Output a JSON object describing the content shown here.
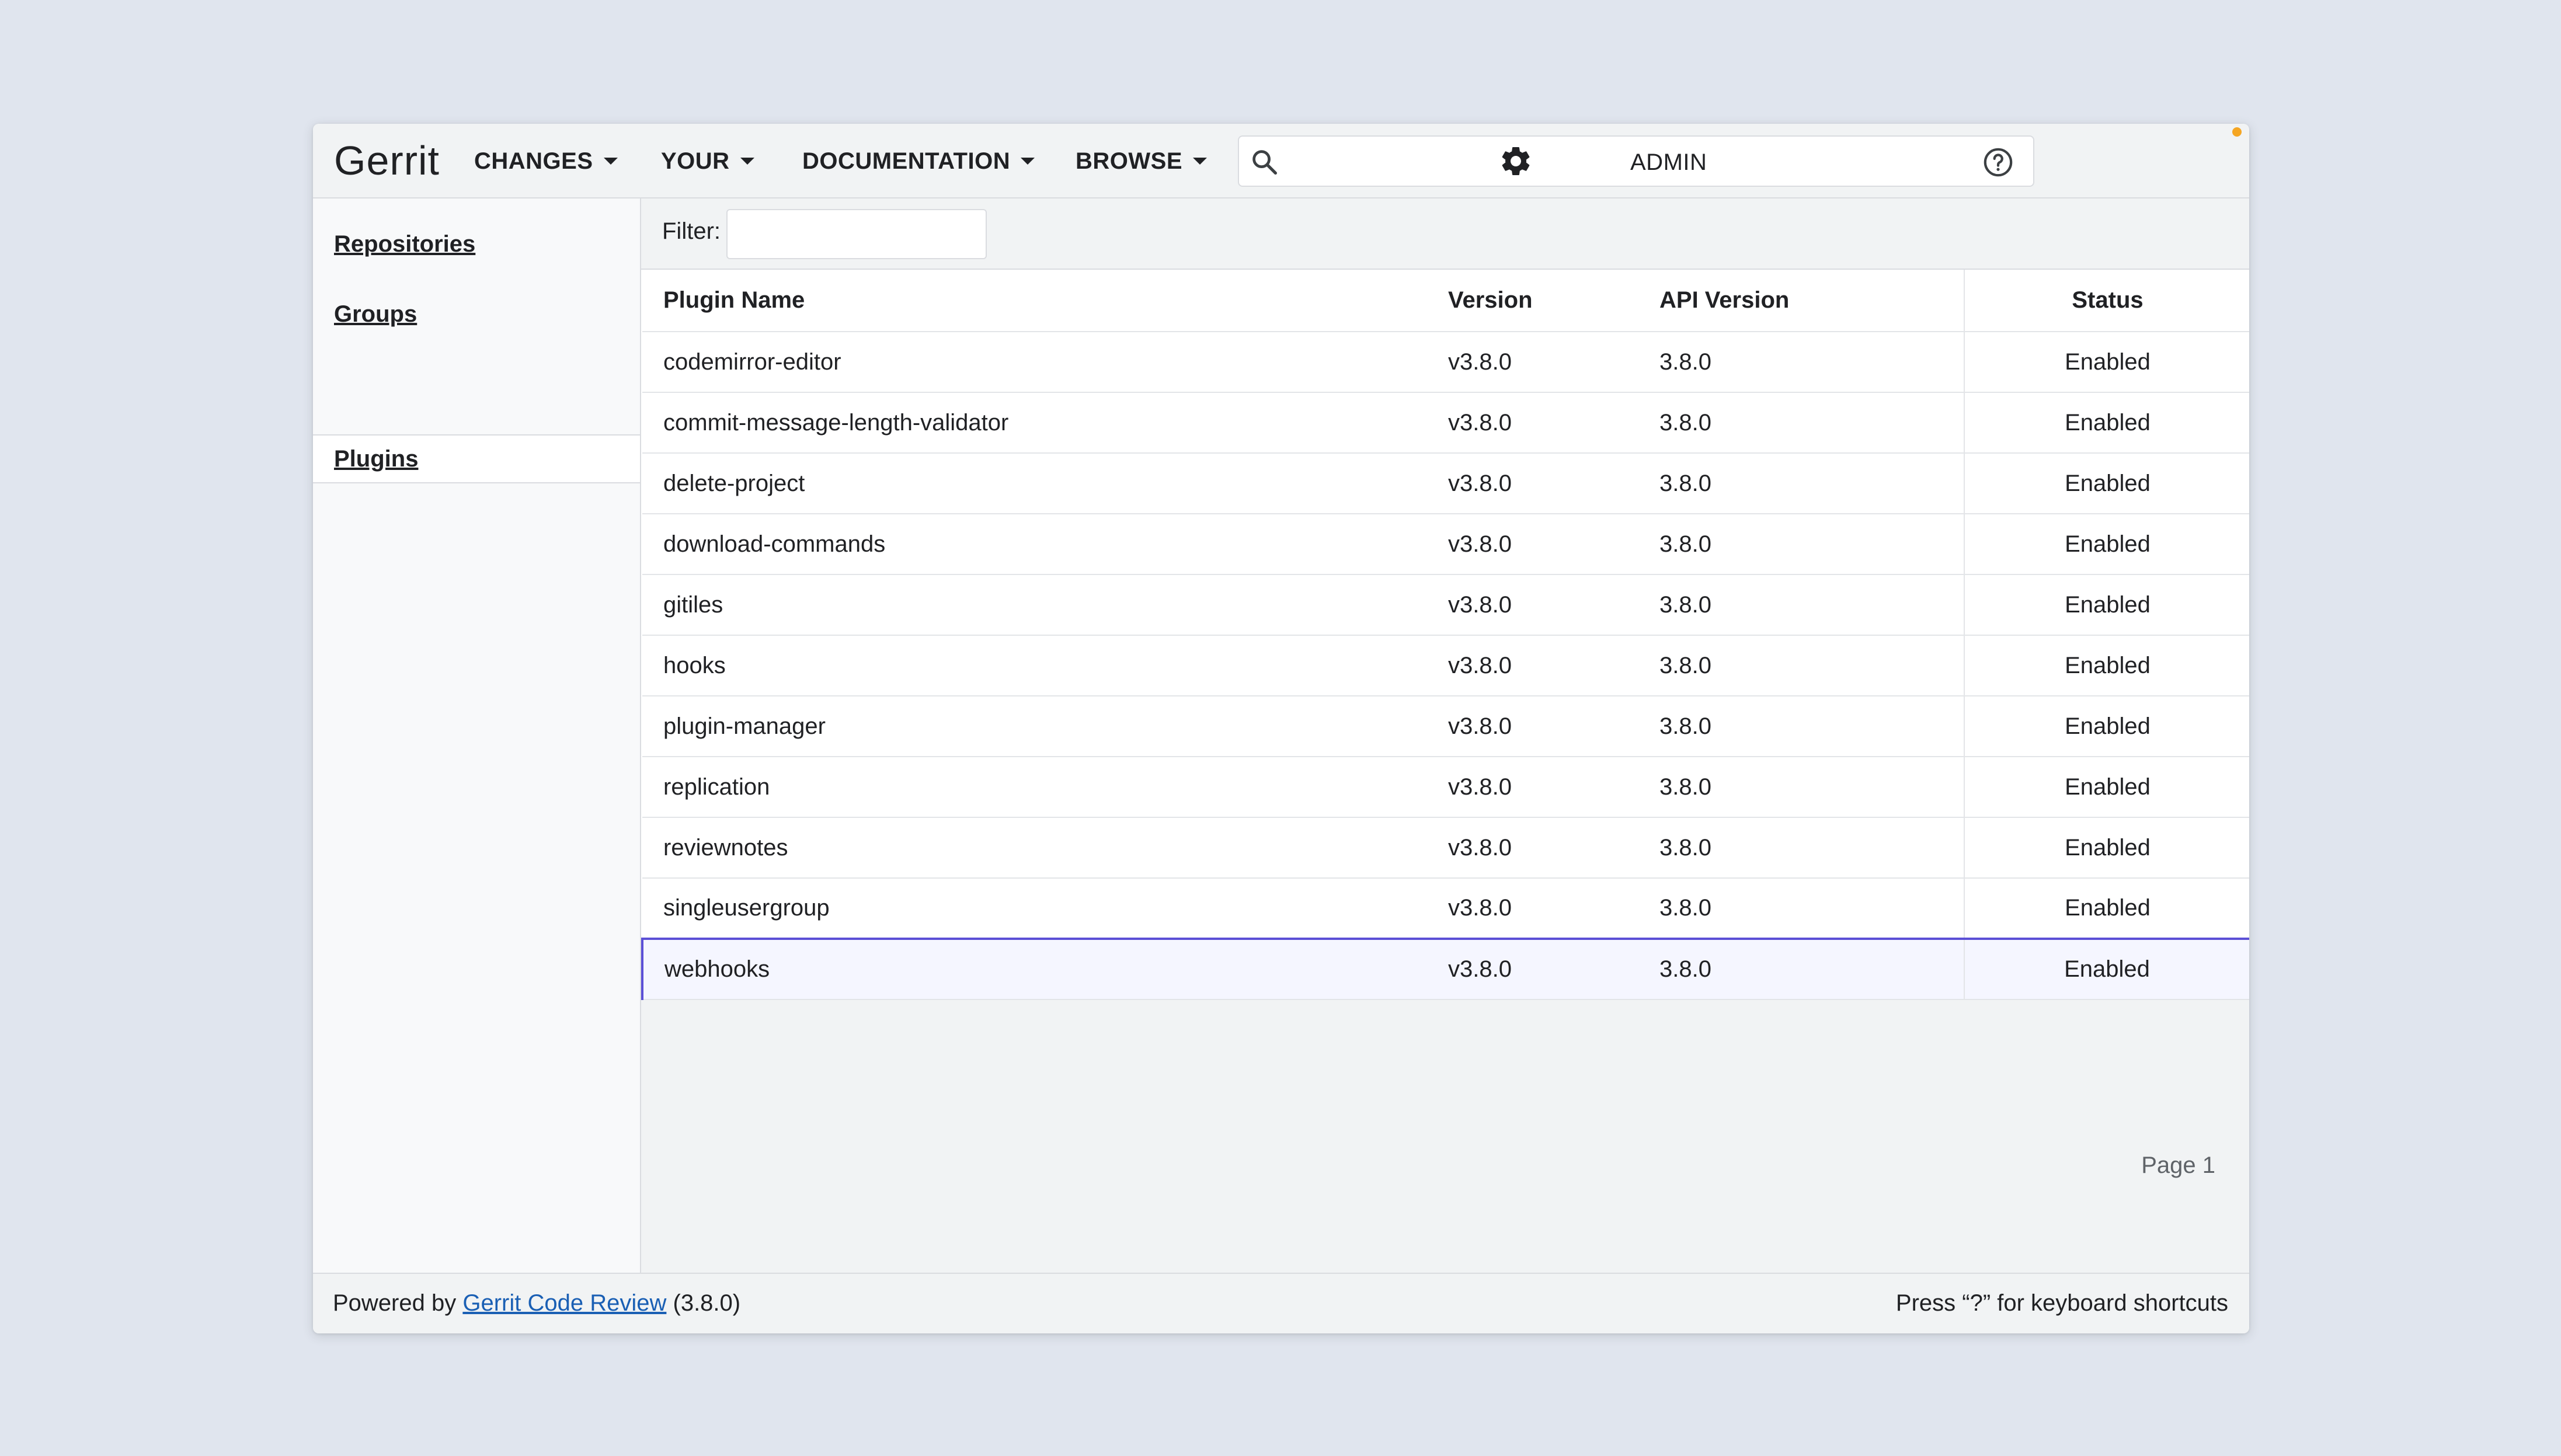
{
  "header": {
    "logo": "Gerrit",
    "nav": [
      {
        "label": "CHANGES"
      },
      {
        "label": "YOUR"
      },
      {
        "label": "DOCUMENTATION"
      },
      {
        "label": "BROWSE"
      }
    ],
    "search": {
      "value": "",
      "placeholder": ""
    },
    "user": "ADMIN"
  },
  "sidebar": {
    "items": [
      {
        "label": "Repositories"
      },
      {
        "label": "Groups"
      },
      {
        "label": "Plugins",
        "active": true
      }
    ]
  },
  "filter": {
    "label": "Filter:",
    "value": ""
  },
  "table": {
    "columns": [
      "Plugin Name",
      "Version",
      "API Version",
      "Status"
    ],
    "rows": [
      {
        "name": "codemirror-editor",
        "version": "v3.8.0",
        "api": "3.8.0",
        "status": "Enabled"
      },
      {
        "name": "commit-message-length-validator",
        "version": "v3.8.0",
        "api": "3.8.0",
        "status": "Enabled"
      },
      {
        "name": "delete-project",
        "version": "v3.8.0",
        "api": "3.8.0",
        "status": "Enabled"
      },
      {
        "name": "download-commands",
        "version": "v3.8.0",
        "api": "3.8.0",
        "status": "Enabled"
      },
      {
        "name": "gitiles",
        "version": "v3.8.0",
        "api": "3.8.0",
        "status": "Enabled"
      },
      {
        "name": "hooks",
        "version": "v3.8.0",
        "api": "3.8.0",
        "status": "Enabled"
      },
      {
        "name": "plugin-manager",
        "version": "v3.8.0",
        "api": "3.8.0",
        "status": "Enabled"
      },
      {
        "name": "replication",
        "version": "v3.8.0",
        "api": "3.8.0",
        "status": "Enabled"
      },
      {
        "name": "reviewnotes",
        "version": "v3.8.0",
        "api": "3.8.0",
        "status": "Enabled"
      },
      {
        "name": "singleusergroup",
        "version": "v3.8.0",
        "api": "3.8.0",
        "status": "Enabled"
      },
      {
        "name": "webhooks",
        "version": "v3.8.0",
        "api": "3.8.0",
        "status": "Enabled"
      }
    ],
    "pager": "Page 1"
  },
  "footer": {
    "powered_prefix": "Powered by",
    "link": "Gerrit Code Review",
    "version": "(3.8.0)",
    "shortcuts": "Press “?” for keyboard shortcuts"
  },
  "colors": {
    "page_bg": "#e0e5ee",
    "selection_border": "#5b4fd6",
    "link": "#1a5fb4",
    "notification_dot": "#f5a623"
  },
  "icons": [
    "search-icon",
    "help-icon",
    "gear-icon",
    "caret-down-icon"
  ]
}
